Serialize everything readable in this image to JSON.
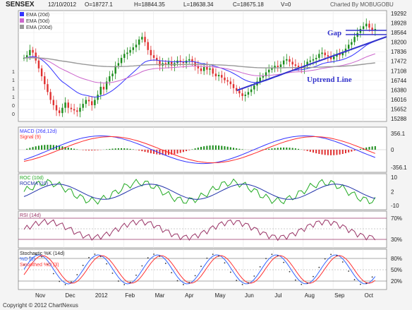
{
  "header": {
    "symbol": "SENSEX",
    "date": "12/10/2012",
    "open": "O=18727.1",
    "high": "H=18844.35",
    "low": "L=18638.34",
    "close": "C=18675.18",
    "volume": "V=0",
    "charted_by": "Charted By MOBUGOBU"
  },
  "footer": "Copyright © 2012 ChartNexus",
  "colors": {
    "price_up": "#1a8c1a",
    "price_down": "#e03030",
    "ema20": "#3333ff",
    "ema50": "#cc66cc",
    "ema200": "#999999",
    "annotation": "#3333cc",
    "macd": "#3333ff",
    "signal": "#ff2a2a",
    "roc": "#22aa22",
    "rocma": "#2233aa",
    "rsi": "#993366",
    "stoch_k": "#333333",
    "stoch_pd": "#3366ff",
    "stoch_spd": "#ff3333"
  },
  "chart_data": {
    "type": "candlestick",
    "x_labels": [
      "Nov",
      "Dec",
      "2012",
      "Feb",
      "Mar",
      "Apr",
      "May",
      "Jun",
      "Jul",
      "Aug",
      "Sep",
      "Oct"
    ],
    "close": [
      17600,
      17700,
      17900,
      17800,
      17500,
      17200,
      16900,
      16600,
      16300,
      16000,
      15800,
      15600,
      15500,
      15700,
      15900,
      15700,
      15650,
      15600,
      15550,
      15700,
      15850,
      16000,
      15950,
      15800,
      16000,
      16200,
      16500,
      16400,
      16700,
      16900,
      17000,
      17300,
      17400,
      17600,
      17750,
      17800,
      17900,
      18000,
      18100,
      18300,
      18400,
      18200,
      17900,
      17700,
      17600,
      17500,
      17300,
      17400,
      17350,
      17450,
      17300,
      17400,
      17500,
      17450,
      17400,
      17500,
      17550,
      17450,
      17300,
      17200,
      17100,
      17250,
      17150,
      17200,
      17000,
      16900,
      16950,
      16850,
      16750,
      16700,
      16600,
      16450,
      16350,
      16250,
      16150,
      16200,
      16300,
      16400,
      16550,
      16700,
      16850,
      16900,
      17050,
      17150,
      17200,
      17300,
      17250,
      17350,
      17500,
      17550,
      17450,
      17350,
      17300,
      17250,
      17200,
      17300,
      17450,
      17500,
      17550,
      17600,
      17750,
      17800,
      17700,
      17650,
      17550,
      17650,
      17750,
      17700,
      17800,
      17950,
      18100,
      18200,
      18400,
      18550,
      18700,
      18800,
      18900,
      18750,
      18650,
      18700
    ],
    "ema_legend": [
      "EMA (20d)",
      "EMA (50d)",
      "EMA (200d)"
    ],
    "price_axis": [
      "19292",
      "18928",
      "18564",
      "18200",
      "17836",
      "17472",
      "17108",
      "16744",
      "16380",
      "16016",
      "15652",
      "15288"
    ],
    "price_left_axis": [
      "1",
      "1",
      "1",
      "1",
      "0",
      "0"
    ],
    "ylim": [
      15288,
      19292
    ],
    "annotations": {
      "gap_label": "Gap",
      "uptrend_label": "Uptrend Line"
    },
    "panels": {
      "macd": {
        "legend_macd": "MACD (26d,12d)",
        "legend_signal": "Signal (9)",
        "axis": [
          "356.1",
          "0",
          "-356.1"
        ]
      },
      "roc": {
        "legend_roc": "ROC (10d)",
        "legend_rocma": "ROCMA (10)",
        "axis": [
          "10",
          "2",
          "-10"
        ]
      },
      "rsi": {
        "legend": "RSI (14d)",
        "axis": [
          "70%",
          "30%"
        ]
      },
      "stoch": {
        "legend_k": "Stochastic %K (14d)",
        "legend_pd": "%D (3)",
        "legend_spd": "Smoothed %D (3)",
        "axis": [
          "80%",
          "50%",
          "20%"
        ]
      }
    }
  }
}
